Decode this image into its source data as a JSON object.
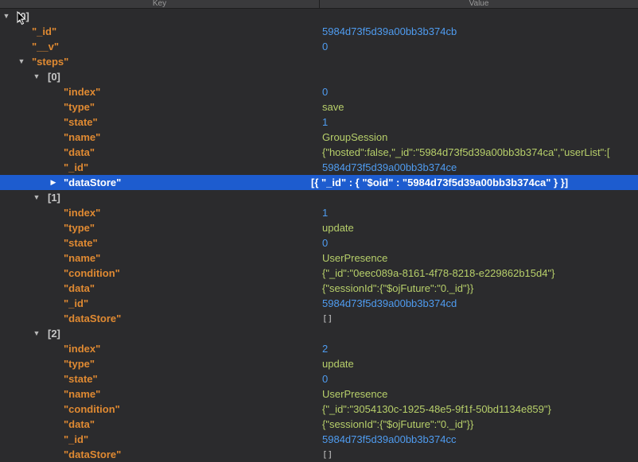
{
  "header": {
    "key_label": "Key",
    "value_label": "Value"
  },
  "rows": [
    {
      "depth": 0,
      "expander": "open",
      "key": "[0]",
      "kind": "bracket",
      "value": "",
      "vtype": ""
    },
    {
      "depth": 1,
      "expander": "none",
      "key": "\"_id\"",
      "kind": "field",
      "value": "5984d73f5d39a00bb3b374cb",
      "vtype": "id"
    },
    {
      "depth": 1,
      "expander": "none",
      "key": "\"__v\"",
      "kind": "field",
      "value": "0",
      "vtype": "num"
    },
    {
      "depth": 1,
      "expander": "open",
      "key": "\"steps\"",
      "kind": "field",
      "value": "",
      "vtype": ""
    },
    {
      "depth": 2,
      "expander": "open",
      "key": "[0]",
      "kind": "bracket",
      "value": "",
      "vtype": ""
    },
    {
      "depth": 3,
      "expander": "none",
      "key": "\"index\"",
      "kind": "field",
      "value": "0",
      "vtype": "num"
    },
    {
      "depth": 3,
      "expander": "none",
      "key": "\"type\"",
      "kind": "field",
      "value": "save",
      "vtype": "str"
    },
    {
      "depth": 3,
      "expander": "none",
      "key": "\"state\"",
      "kind": "field",
      "value": "1",
      "vtype": "num"
    },
    {
      "depth": 3,
      "expander": "none",
      "key": "\"name\"",
      "kind": "field",
      "value": "GroupSession",
      "vtype": "str"
    },
    {
      "depth": 3,
      "expander": "none",
      "key": "\"data\"",
      "kind": "field",
      "value": "{\"hosted\":false,\"_id\":\"5984d73f5d39a00bb3b374ca\",\"userList\":[",
      "vtype": "obj"
    },
    {
      "depth": 3,
      "expander": "none",
      "key": "\"_id\"",
      "kind": "field",
      "value": "5984d73f5d39a00bb3b374ce",
      "vtype": "id"
    },
    {
      "depth": 3,
      "expander": "closed",
      "key": "\"dataStore\"",
      "kind": "field",
      "value": "[{ \"_id\" : { \"$oid\" : \"5984d73f5d39a00bb3b374ca\" } }]",
      "vtype": "obj",
      "selected": true
    },
    {
      "depth": 2,
      "expander": "open",
      "key": "[1]",
      "kind": "bracket",
      "value": "",
      "vtype": ""
    },
    {
      "depth": 3,
      "expander": "none",
      "key": "\"index\"",
      "kind": "field",
      "value": "1",
      "vtype": "num"
    },
    {
      "depth": 3,
      "expander": "none",
      "key": "\"type\"",
      "kind": "field",
      "value": "update",
      "vtype": "str"
    },
    {
      "depth": 3,
      "expander": "none",
      "key": "\"state\"",
      "kind": "field",
      "value": "0",
      "vtype": "num"
    },
    {
      "depth": 3,
      "expander": "none",
      "key": "\"name\"",
      "kind": "field",
      "value": "UserPresence",
      "vtype": "str"
    },
    {
      "depth": 3,
      "expander": "none",
      "key": "\"condition\"",
      "kind": "field",
      "value": "{\"_id\":\"0eec089a-8161-4f78-8218-e229862b15d4\"}",
      "vtype": "obj"
    },
    {
      "depth": 3,
      "expander": "none",
      "key": "\"data\"",
      "kind": "field",
      "value": "{\"sessionId\":{\"$ojFuture\":\"0._id\"}}",
      "vtype": "obj"
    },
    {
      "depth": 3,
      "expander": "none",
      "key": "\"_id\"",
      "kind": "field",
      "value": "5984d73f5d39a00bb3b374cd",
      "vtype": "id"
    },
    {
      "depth": 3,
      "expander": "none",
      "key": "\"dataStore\"",
      "kind": "field",
      "value": "[]",
      "vtype": "empty"
    },
    {
      "depth": 2,
      "expander": "open",
      "key": "[2]",
      "kind": "bracket",
      "value": "",
      "vtype": ""
    },
    {
      "depth": 3,
      "expander": "none",
      "key": "\"index\"",
      "kind": "field",
      "value": "2",
      "vtype": "num"
    },
    {
      "depth": 3,
      "expander": "none",
      "key": "\"type\"",
      "kind": "field",
      "value": "update",
      "vtype": "str"
    },
    {
      "depth": 3,
      "expander": "none",
      "key": "\"state\"",
      "kind": "field",
      "value": "0",
      "vtype": "num"
    },
    {
      "depth": 3,
      "expander": "none",
      "key": "\"name\"",
      "kind": "field",
      "value": "UserPresence",
      "vtype": "str"
    },
    {
      "depth": 3,
      "expander": "none",
      "key": "\"condition\"",
      "kind": "field",
      "value": "{\"_id\":\"3054130c-1925-48e5-9f1f-50bd1134e859\"}",
      "vtype": "obj"
    },
    {
      "depth": 3,
      "expander": "none",
      "key": "\"data\"",
      "kind": "field",
      "value": "{\"sessionId\":{\"$ojFuture\":\"0._id\"}}",
      "vtype": "obj"
    },
    {
      "depth": 3,
      "expander": "none",
      "key": "\"_id\"",
      "kind": "field",
      "value": "5984d73f5d39a00bb3b374cc",
      "vtype": "id"
    },
    {
      "depth": 3,
      "expander": "none",
      "key": "\"dataStore\"",
      "kind": "field",
      "value": "[]",
      "vtype": "empty"
    }
  ],
  "colors": {
    "background": "#2b2b2d",
    "key": "#e08a32",
    "number": "#4f9cf0",
    "string": "#b7cf6a",
    "selection": "#1d5ccf"
  },
  "icons": {
    "expanded": "triangle-down-icon",
    "collapsed": "triangle-right-icon",
    "pointer": "mouse-pointer-icon"
  }
}
